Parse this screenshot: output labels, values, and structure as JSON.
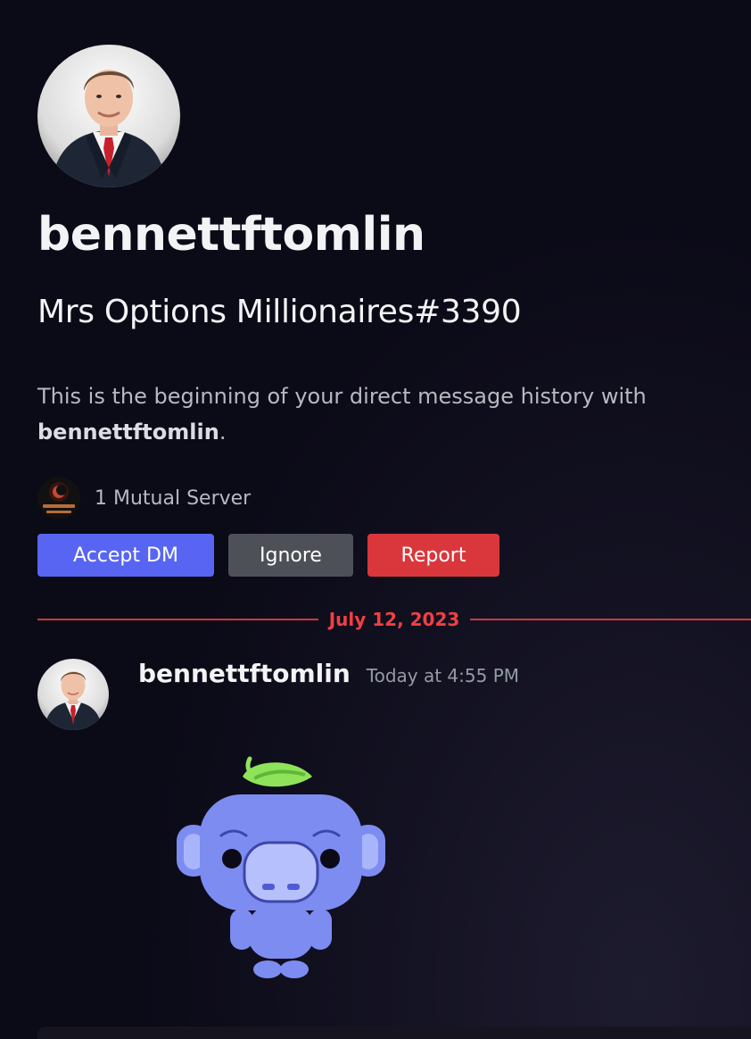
{
  "profile": {
    "username": "bennettftomlin",
    "tag": "Mrs Options Millionaires#3390",
    "intro_prefix": "This is the beginning of your direct message history with ",
    "intro_name": "bennettftomlin",
    "intro_suffix": ".",
    "mutual_servers": "1 Mutual Server"
  },
  "actions": {
    "accept_label": "Accept DM",
    "ignore_label": "Ignore",
    "report_label": "Report"
  },
  "date_divider": "July 12, 2023",
  "message": {
    "author": "bennettftomlin",
    "timestamp": "Today at 4:55 PM",
    "sticker": "wumpus-with-leaf-sticker"
  },
  "colors": {
    "background": "#0b0a17",
    "accept": "#5865f2",
    "ignore": "#4e5058",
    "report": "#da373c",
    "divider": "#f23f43"
  }
}
